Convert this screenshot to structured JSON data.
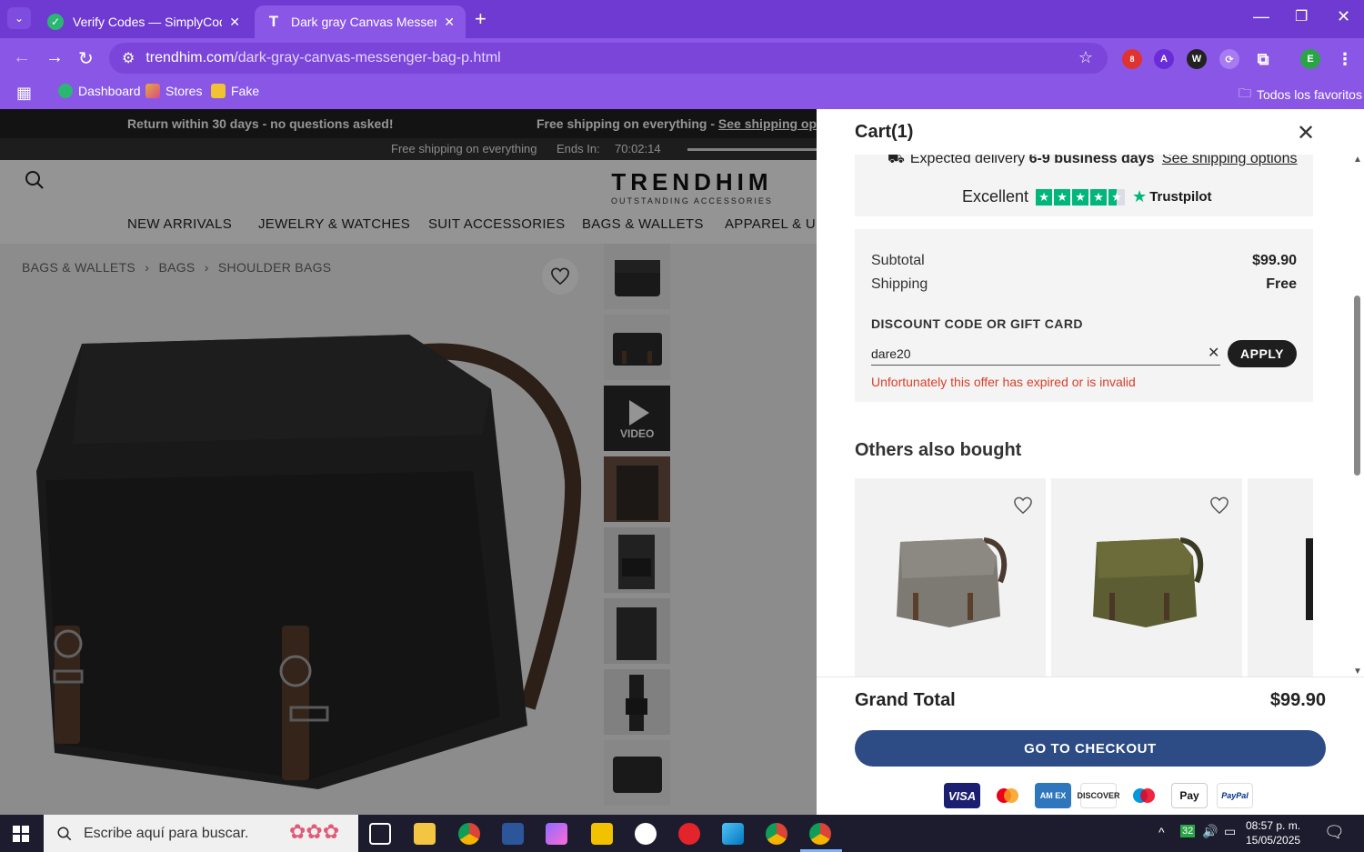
{
  "browser": {
    "tabs": [
      {
        "title": "Verify Codes — SimplyCodes",
        "active": false
      },
      {
        "title": "Dark gray Canvas Messenger Ba",
        "active": true
      }
    ],
    "url_host": "trendhim.com",
    "url_path": "/dark-gray-canvas-messenger-bag-p.html",
    "extension_badge": "8",
    "profile_initial": "E",
    "bookmarks": [
      "Dashboard",
      "Stores",
      "Fake"
    ],
    "all_bookmarks": "Todos los favoritos"
  },
  "site": {
    "promo_left": "Return within 30 days - no questions asked!",
    "promo_right_text": "Free shipping on everything - ",
    "promo_right_link": "See shipping options",
    "countdown_label": "Free shipping on everything",
    "countdown_ends": "Ends In:",
    "countdown_time": "70:02:14",
    "logo": "TRENDHIM",
    "logo_tagline": "OUTSTANDING ACCESSORIES",
    "nav": [
      "NEW ARRIVALS",
      "JEWELRY & WATCHES",
      "SUIT ACCESSORIES",
      "BAGS & WALLETS",
      "APPAREL & UNI"
    ],
    "breadcrumb": [
      "BAGS & WALLETS",
      "BAGS",
      "SHOULDER BAGS"
    ],
    "video_label": "VIDEO"
  },
  "cart": {
    "title": "Cart(1)",
    "delivery_prefix": "Expected delivery",
    "delivery_days": "6-9 business days",
    "delivery_link": "See shipping options",
    "rating_word": "Excellent",
    "rating_brand": "Trustpilot",
    "subtotal_label": "Subtotal",
    "subtotal_value": "$99.90",
    "shipping_label": "Shipping",
    "shipping_value": "Free",
    "discount_label": "DISCOUNT CODE OR GIFT CARD",
    "discount_value": "dare20",
    "apply_label": "APPLY",
    "error_text": "Unfortunately this offer has expired or is invalid",
    "others_heading": "Others also bought",
    "grand_total_label": "Grand Total",
    "grand_total_value": "$99.90",
    "checkout_label": "GO TO CHECKOUT",
    "payment_methods": [
      "VISA",
      "Mastercard",
      "American Express",
      "Discover",
      "Maestro",
      "Apple Pay",
      "PayPal"
    ]
  },
  "taskbar": {
    "search_placeholder": "Escribe aquí para buscar.",
    "time": "08:57 p. m.",
    "date": "15/05/2025",
    "tray_badge": "32"
  },
  "colors": {
    "browser_frame": "#6f3ad1",
    "checkout_button": "#2d4b84",
    "error_red": "#d9402b",
    "trustpilot_green": "#00b67a"
  }
}
